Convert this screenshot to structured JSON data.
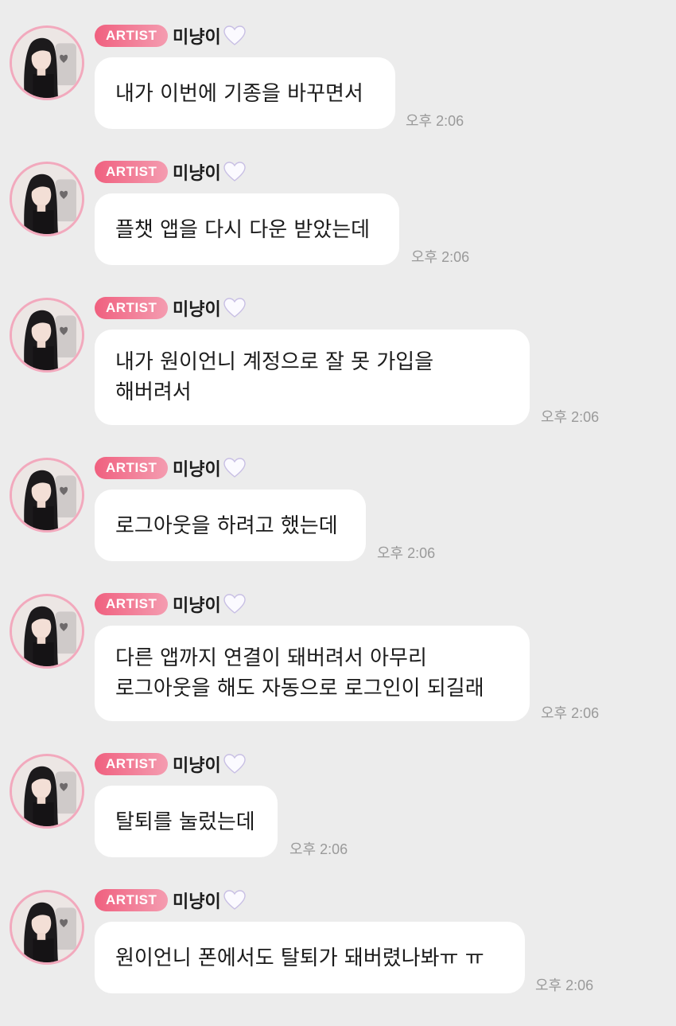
{
  "messages": [
    {
      "badge": "ARTIST",
      "name": "미냥이",
      "text": "내가 이번에 기종을 바꾸면서",
      "time": "오후 2:06"
    },
    {
      "badge": "ARTIST",
      "name": "미냥이",
      "text": "플챗 앱을 다시 다운 받았는데",
      "time": "오후 2:06"
    },
    {
      "badge": "ARTIST",
      "name": "미냥이",
      "text": "내가 원이언니 계정으로 잘 못 가입을\n해버려서",
      "time": "오후 2:06"
    },
    {
      "badge": "ARTIST",
      "name": "미냥이",
      "text": "로그아웃을 하려고 했는데",
      "time": "오후 2:06"
    },
    {
      "badge": "ARTIST",
      "name": "미냥이",
      "text": "다른 앱까지 연결이 돼버려서 아무리\n로그아웃을 해도 자동으로 로그인이 되길래",
      "time": "오후 2:06"
    },
    {
      "badge": "ARTIST",
      "name": "미냥이",
      "text": "탈퇴를 눌렀는데",
      "time": "오후 2:06"
    },
    {
      "badge": "ARTIST",
      "name": "미냥이",
      "text": "원이언니 폰에서도 탈퇴가 돼버렸나봐ㅠ ㅠ",
      "time": "오후 2:06"
    }
  ],
  "colors": {
    "background": "#ececec",
    "bubble": "#ffffff",
    "badge_start": "#f0607f",
    "badge_end": "#f49cb0",
    "avatar_ring": "#f2a9bd",
    "timestamp": "#9a9a9a"
  },
  "icons": {
    "name_suffix": "white-heart-icon",
    "avatar": "artist-avatar"
  }
}
